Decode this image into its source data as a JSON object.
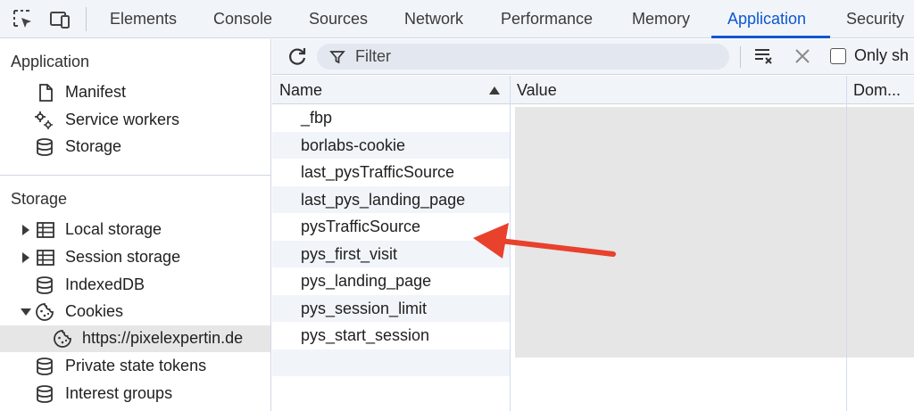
{
  "tabs": [
    {
      "label": "Elements",
      "active": false
    },
    {
      "label": "Console",
      "active": false
    },
    {
      "label": "Sources",
      "active": false
    },
    {
      "label": "Network",
      "active": false
    },
    {
      "label": "Performance",
      "active": false
    },
    {
      "label": "Memory",
      "active": false
    },
    {
      "label": "Application",
      "active": true
    },
    {
      "label": "Security",
      "active": false
    }
  ],
  "sidebar": {
    "application_title": "Application",
    "application_items": [
      {
        "label": "Manifest",
        "icon": "document-icon"
      },
      {
        "label": "Service workers",
        "icon": "gears-icon"
      },
      {
        "label": "Storage",
        "icon": "database-icon"
      }
    ],
    "storage_title": "Storage",
    "storage_items": [
      {
        "label": "Local storage",
        "icon": "grid-icon",
        "expander": "collapsed"
      },
      {
        "label": "Session storage",
        "icon": "grid-icon",
        "expander": "collapsed"
      },
      {
        "label": "IndexedDB",
        "icon": "database-icon"
      },
      {
        "label": "Cookies",
        "icon": "cookie-icon",
        "expander": "expanded"
      },
      {
        "label": "https://pixelexpertin.de",
        "icon": "cookie-icon",
        "selected": true
      },
      {
        "label": "Private state tokens",
        "icon": "database-icon"
      },
      {
        "label": "Interest groups",
        "icon": "database-icon"
      }
    ]
  },
  "toolbar": {
    "filter_placeholder": "Filter",
    "only_label": "Only sh"
  },
  "table": {
    "headers": {
      "name": "Name",
      "value": "Value",
      "domain": "Dom..."
    },
    "rows": [
      "_fbp",
      "borlabs-cookie",
      "last_pysTrafficSource",
      "last_pys_landing_page",
      "pysTrafficSource",
      "pys_first_visit",
      "pys_landing_page",
      "pys_session_limit",
      "pys_start_session"
    ]
  },
  "colors": {
    "accent": "#0b57d0",
    "annotation_arrow": "#e8412c"
  }
}
